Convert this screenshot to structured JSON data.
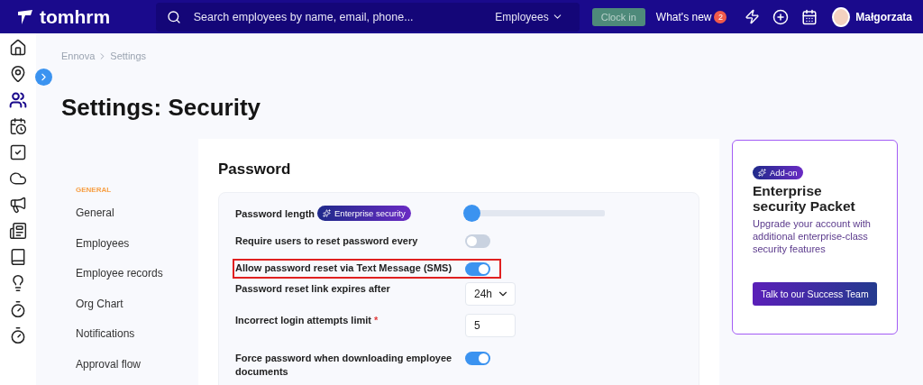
{
  "topbar": {
    "logo": "tomhrm",
    "search": {
      "placeholder": "Search employees by name, email, phone..."
    },
    "scope": "Employees",
    "clock_in": "Clock in",
    "whats_new": "What's new",
    "whats_new_count": "2",
    "user": "Małgorzata"
  },
  "rail": [
    {
      "selected": false
    },
    {
      "selected": false
    },
    {
      "selected": true
    },
    {
      "selected": false
    },
    {
      "selected": false
    },
    {
      "selected": false
    },
    {
      "selected": false
    },
    {
      "selected": false
    },
    {
      "selected": false
    },
    {
      "selected": false
    },
    {
      "selected": false
    },
    {
      "selected": false
    }
  ],
  "breadcrumb": [
    "Ennova",
    "Settings"
  ],
  "title": "Settings: Security",
  "nav": {
    "heading": "GENERAL",
    "items": [
      {
        "label": "General",
        "selected": false
      },
      {
        "label": "Employees",
        "selected": false
      },
      {
        "label": "Employee records",
        "selected": false
      },
      {
        "label": "Org Chart",
        "selected": false
      },
      {
        "label": "Notifications",
        "selected": false
      },
      {
        "label": "Approval flow",
        "selected": false
      }
    ]
  },
  "section": {
    "title": "Password",
    "rows": [
      {
        "kind": "slider",
        "label": "Password length",
        "badge": "Enterprise security",
        "level": 0,
        "highlighted": false
      },
      {
        "kind": "toggle",
        "label": "Require users to reset password every",
        "on": false,
        "highlighted": false
      },
      {
        "kind": "toggle",
        "label": "Allow password reset via Text Message (SMS)",
        "on": true,
        "highlighted": true
      },
      {
        "kind": "select",
        "label": "Password reset link expires after",
        "value": "24h",
        "highlighted": false
      },
      {
        "kind": "input",
        "label": "Incorrect login attempts limit",
        "required_mark": "*",
        "value": "5",
        "highlighted": false
      },
      {
        "kind": "toggle",
        "label": "Force password when downloading employee documents",
        "on": true,
        "highlighted": false
      }
    ]
  },
  "promo": {
    "badge": "Add-on",
    "title": "Enterprise security Packet",
    "text": "Upgrade your account with additional enterprise-class security features",
    "button": "Talk to our Success Team"
  }
}
